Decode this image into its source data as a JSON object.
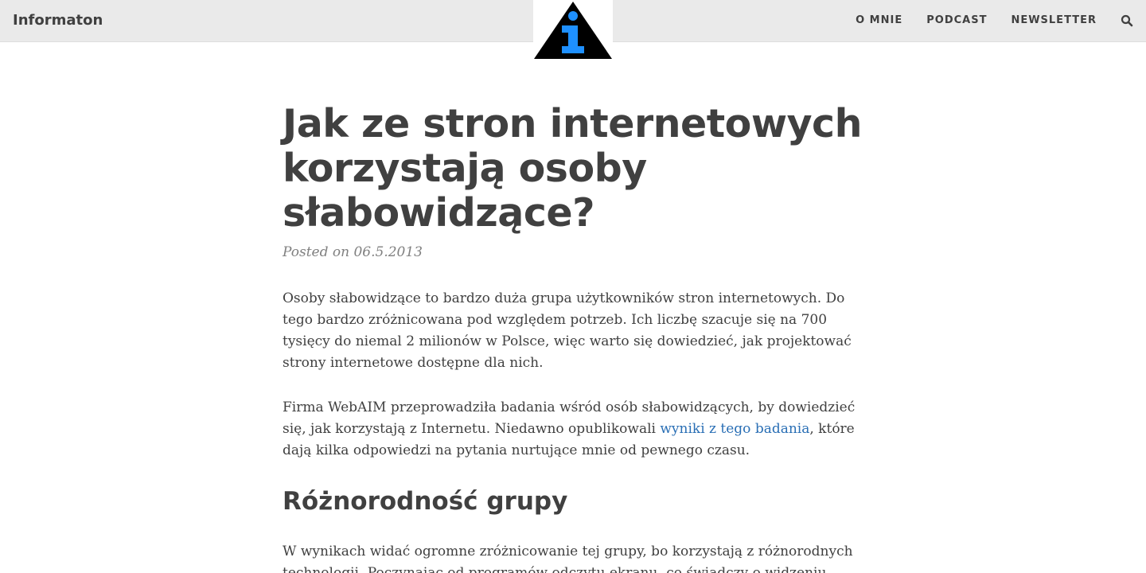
{
  "header": {
    "brand": "Informaton",
    "nav": [
      "O MNIE",
      "PODCAST",
      "NEWSLETTER"
    ],
    "search_icon": "search-icon",
    "logo_icon": "info-triangle-logo"
  },
  "colors": {
    "header_bg": "#eaeaea",
    "text": "#404040",
    "meta": "#808080",
    "link": "#2a6fb5",
    "logo_triangle": "#000000",
    "logo_i": "#1e90ff"
  },
  "article": {
    "title": "Jak ze stron internetowych korzystają osoby słabowidzące?",
    "meta": "Posted on 06.5.2013",
    "p1": "Osoby słabowidzące to bardzo duża grupa użytkowników stron internetowych. Do tego bardzo zróżnicowana pod względem potrzeb. Ich liczbę szacuje się na 700 tysięcy do niemal 2 milionów w Polsce, więc warto się dowiedzieć, jak projektować strony internetowe dostępne dla nich.",
    "p2_before": "Firma WebAIM przeprowadziła badania wśród osób słabowidzących, by dowiedzieć się, jak korzystają z Internetu. Niedawno opublikowali ",
    "p2_link": "wyniki z tego badania",
    "p2_after": ", które dają kilka odpowiedzi na pytania nurtujące mnie od pewnego czasu.",
    "h2": "Różnorodność grupy",
    "p3": "W wynikach widać ogromne zróżnicowanie tej grupy, bo korzystają z różnorodnych technologii. Poczynając od programów odczytu ekranu, co świadczy o widzeniu"
  }
}
